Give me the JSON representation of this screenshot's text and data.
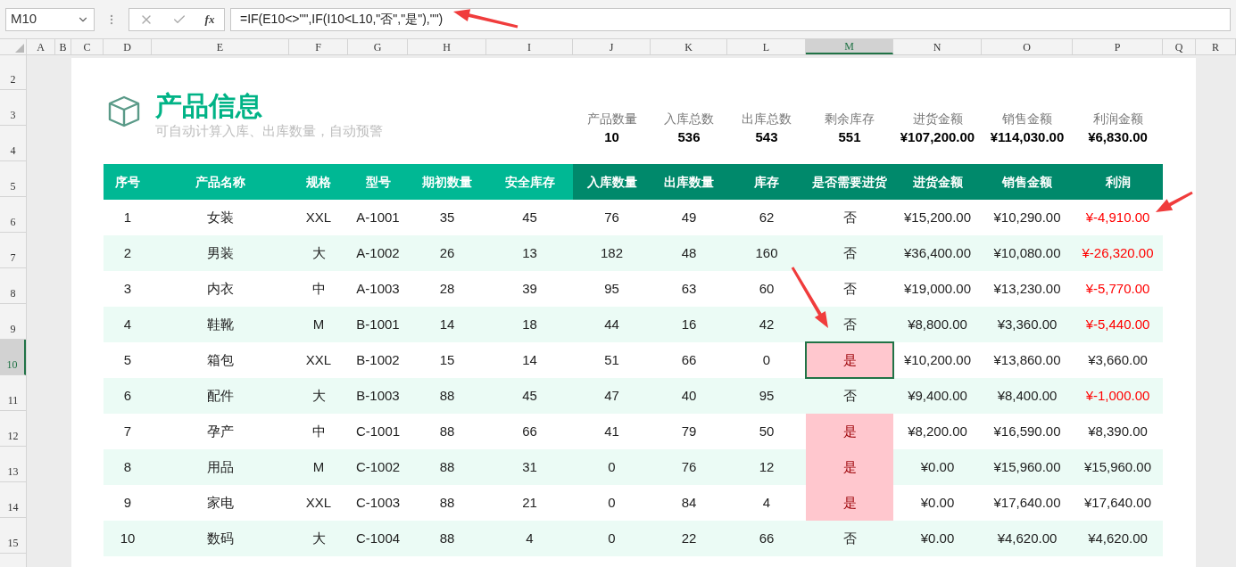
{
  "formula_bar": {
    "name_box": "M10",
    "function_label": "fx",
    "formula": "=IF(E10<>\"\",IF(I10<L10,\"否\",\"是\"),\"\")"
  },
  "column_letters": [
    {
      "label": "A",
      "selected": false
    },
    {
      "label": "B",
      "selected": false
    },
    {
      "label": "C",
      "selected": false
    },
    {
      "label": "D",
      "selected": false
    },
    {
      "label": "E",
      "selected": false
    },
    {
      "label": "F",
      "selected": false
    },
    {
      "label": "G",
      "selected": false
    },
    {
      "label": "H",
      "selected": false
    },
    {
      "label": "I",
      "selected": false
    },
    {
      "label": "J",
      "selected": false
    },
    {
      "label": "K",
      "selected": false
    },
    {
      "label": "L",
      "selected": false
    },
    {
      "label": "M",
      "selected": true
    },
    {
      "label": "N",
      "selected": false
    },
    {
      "label": "O",
      "selected": false
    },
    {
      "label": "P",
      "selected": false
    },
    {
      "label": "Q",
      "selected": false
    },
    {
      "label": "R",
      "selected": false
    }
  ],
  "row_numbers": [
    {
      "label": "2",
      "selected": false
    },
    {
      "label": "3",
      "selected": false
    },
    {
      "label": "4",
      "selected": false
    },
    {
      "label": "5",
      "selected": false
    },
    {
      "label": "6",
      "selected": false
    },
    {
      "label": "7",
      "selected": false
    },
    {
      "label": "8",
      "selected": false
    },
    {
      "label": "9",
      "selected": false
    },
    {
      "label": "10",
      "selected": true
    },
    {
      "label": "11",
      "selected": false
    },
    {
      "label": "12",
      "selected": false
    },
    {
      "label": "13",
      "selected": false
    },
    {
      "label": "14",
      "selected": false
    },
    {
      "label": "15",
      "selected": false
    }
  ],
  "header": {
    "title": "产品信息",
    "subtitle": "可自动计算入库、出库数量，自动预警"
  },
  "summary": [
    {
      "label": "产品数量",
      "value": "10"
    },
    {
      "label": "入库总数",
      "value": "536"
    },
    {
      "label": "出库总数",
      "value": "543"
    },
    {
      "label": "剩余库存",
      "value": "551"
    },
    {
      "label": "进货金额",
      "value": "¥107,200.00"
    },
    {
      "label": "销售金额",
      "value": "¥114,030.00"
    },
    {
      "label": "利润金额",
      "value": "¥6,830.00"
    }
  ],
  "table": {
    "columns": [
      {
        "label": "序号",
        "kind": "input"
      },
      {
        "label": "产品名称",
        "kind": "input"
      },
      {
        "label": "规格",
        "kind": "input"
      },
      {
        "label": "型号",
        "kind": "input"
      },
      {
        "label": "期初数量",
        "kind": "input"
      },
      {
        "label": "安全库存",
        "kind": "input"
      },
      {
        "label": "入库数量",
        "kind": "calc"
      },
      {
        "label": "出库数量",
        "kind": "calc"
      },
      {
        "label": "库存",
        "kind": "calc"
      },
      {
        "label": "是否需要进货",
        "kind": "calc"
      },
      {
        "label": "进货金额",
        "kind": "calc"
      },
      {
        "label": "销售金额",
        "kind": "calc"
      },
      {
        "label": "利润",
        "kind": "calc"
      }
    ],
    "rows": [
      {
        "cells": [
          "1",
          "女装",
          "XXL",
          "A-1001",
          "35",
          "45",
          "76",
          "49",
          "62",
          "否",
          "¥15,200.00",
          "¥10,290.00",
          "¥-4,910.00"
        ],
        "restock_alert": false,
        "selected": false,
        "loss": true
      },
      {
        "cells": [
          "2",
          "男装",
          "大",
          "A-1002",
          "26",
          "13",
          "182",
          "48",
          "160",
          "否",
          "¥36,400.00",
          "¥10,080.00",
          "¥-26,320.00"
        ],
        "restock_alert": false,
        "selected": false,
        "loss": true
      },
      {
        "cells": [
          "3",
          "内衣",
          "中",
          "A-1003",
          "28",
          "39",
          "95",
          "63",
          "60",
          "否",
          "¥19,000.00",
          "¥13,230.00",
          "¥-5,770.00"
        ],
        "restock_alert": false,
        "selected": false,
        "loss": true
      },
      {
        "cells": [
          "4",
          "鞋靴",
          "M",
          "B-1001",
          "14",
          "18",
          "44",
          "16",
          "42",
          "否",
          "¥8,800.00",
          "¥3,360.00",
          "¥-5,440.00"
        ],
        "restock_alert": false,
        "selected": false,
        "loss": true
      },
      {
        "cells": [
          "5",
          "箱包",
          "XXL",
          "B-1002",
          "15",
          "14",
          "51",
          "66",
          "0",
          "是",
          "¥10,200.00",
          "¥13,860.00",
          "¥3,660.00"
        ],
        "restock_alert": true,
        "selected": true,
        "loss": false
      },
      {
        "cells": [
          "6",
          "配件",
          "大",
          "B-1003",
          "88",
          "45",
          "47",
          "40",
          "95",
          "否",
          "¥9,400.00",
          "¥8,400.00",
          "¥-1,000.00"
        ],
        "restock_alert": false,
        "selected": false,
        "loss": true
      },
      {
        "cells": [
          "7",
          "孕产",
          "中",
          "C-1001",
          "88",
          "66",
          "41",
          "79",
          "50",
          "是",
          "¥8,200.00",
          "¥16,590.00",
          "¥8,390.00"
        ],
        "restock_alert": true,
        "selected": false,
        "loss": false
      },
      {
        "cells": [
          "8",
          "用品",
          "M",
          "C-1002",
          "88",
          "31",
          "0",
          "76",
          "12",
          "是",
          "¥0.00",
          "¥15,960.00",
          "¥15,960.00"
        ],
        "restock_alert": true,
        "selected": false,
        "loss": false
      },
      {
        "cells": [
          "9",
          "家电",
          "XXL",
          "C-1003",
          "88",
          "21",
          "0",
          "84",
          "4",
          "是",
          "¥0.00",
          "¥17,640.00",
          "¥17,640.00"
        ],
        "restock_alert": true,
        "selected": false,
        "loss": false
      },
      {
        "cells": [
          "10",
          "数码",
          "大",
          "C-1004",
          "88",
          "4",
          "0",
          "22",
          "66",
          "否",
          "¥0.00",
          "¥4,620.00",
          "¥4,620.00"
        ],
        "restock_alert": false,
        "selected": false,
        "loss": false
      }
    ]
  }
}
